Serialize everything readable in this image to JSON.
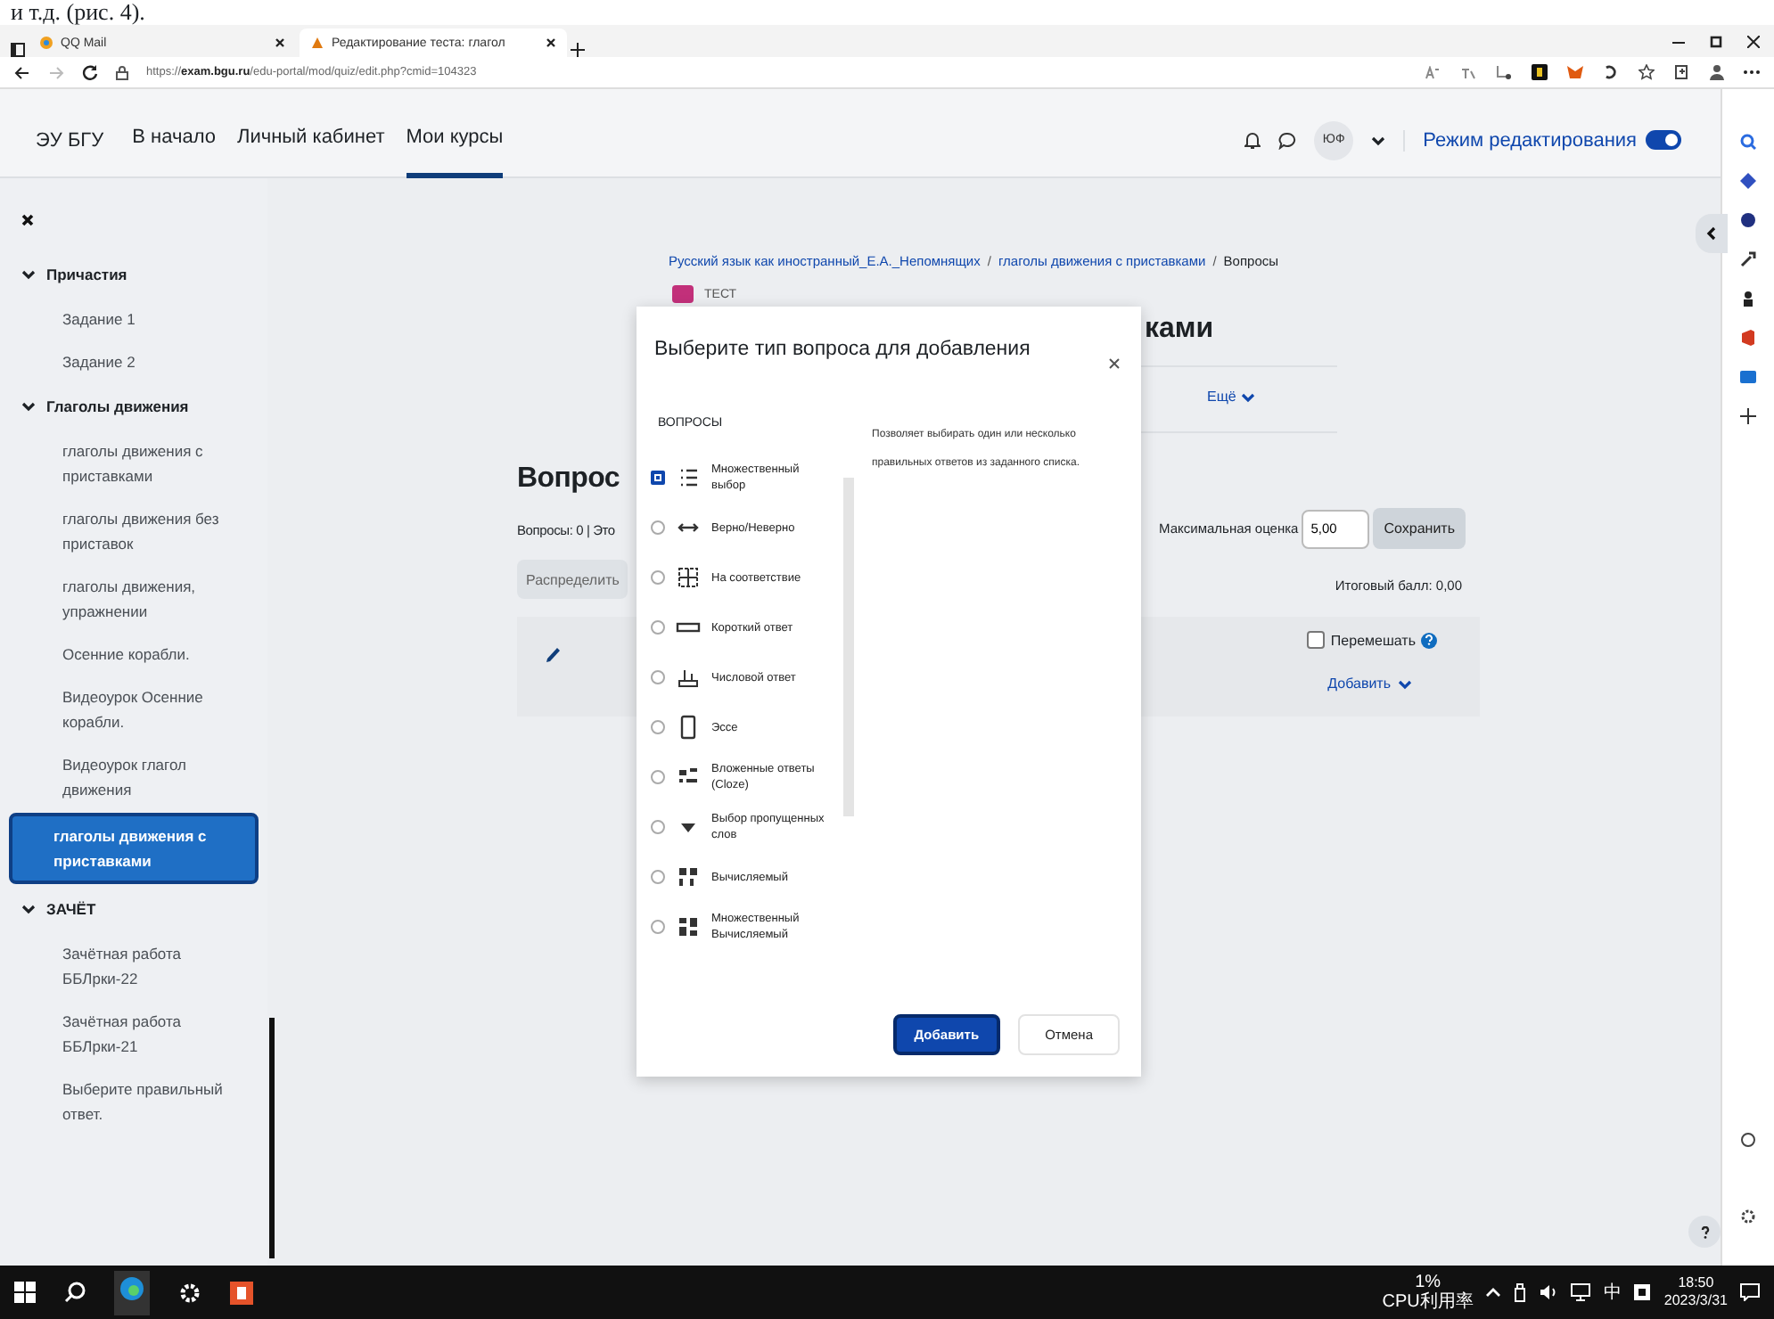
{
  "document_text": "и т.д. (рис. 4).",
  "browser": {
    "tabs": [
      {
        "title": "QQ Mail",
        "selected": false
      },
      {
        "title": "Редактирование теста: глагол",
        "selected": true
      }
    ],
    "url": "https://**exam.bgu.ru**/edu-portal/mod/quiz/edit.php?cmid=104323"
  },
  "nav": {
    "brand": "ЭУ БГУ",
    "links": [
      {
        "label": "В начало",
        "selected": false
      },
      {
        "label": "Личный кабинет",
        "selected": false
      },
      {
        "label": "Мои курсы",
        "selected": true
      }
    ],
    "user_initials": "ЮФ",
    "edit_mode": {
      "label": "Режим редактирования",
      "on": true
    }
  },
  "sidebar": {
    "sections": [
      {
        "title": "Причастия",
        "expanded": true,
        "items": [
          {
            "label": "Задание 1",
            "selected": false
          },
          {
            "label": "Задание 2",
            "selected": false
          }
        ]
      },
      {
        "title": "Глаголы движения",
        "expanded": true,
        "items": [
          {
            "label": "глаголы движения с приставками",
            "selected": false
          },
          {
            "label": "глаголы движения без приставок",
            "selected": false
          },
          {
            "label": "глаголы движения, упражнении",
            "selected": false
          },
          {
            "label": "Осенние корабли.",
            "selected": false
          },
          {
            "label": "Видеоурок Осенние корабли.",
            "selected": false
          },
          {
            "label": "Видеоурок глагол движения",
            "selected": false
          },
          {
            "label": "глаголы движения с приставками",
            "selected": true
          }
        ]
      },
      {
        "title": "ЗАЧЁТ",
        "expanded": true,
        "items": [
          {
            "label": "Зачётная работа ББЛрки-22",
            "selected": false
          },
          {
            "label": "Зачётная работа ББЛрки-21",
            "selected": false
          },
          {
            "label": "Выберите правильный ответ.",
            "selected": false
          }
        ]
      }
    ]
  },
  "page": {
    "breadcrumb": [
      "Русский язык как иностранный_Е.А._Непомнящих",
      "глаголы движения с приставками",
      "Вопросы"
    ],
    "breadcrumb_separator": "/",
    "activity_badge": "ТЕСТ",
    "title": "ками",
    "more_menu": "Ещё",
    "questions_heading": "Вопрос",
    "questions_info": "Вопросы: 0 | Это",
    "repaginate_button": "Распределить",
    "max_grade_label": "Максимальная оценка",
    "max_grade_value": "5,00",
    "save_button": "Сохранить",
    "total": "Итоговый балл: 0,00",
    "shuffle": {
      "label": "Перемешать",
      "checked": false
    },
    "add_menu": "Добавить"
  },
  "dialog": {
    "title": "Выберите тип вопроса для добавления",
    "section_heading": "ВОПРОСЫ",
    "options": [
      {
        "label": "Множественный выбор",
        "kind": "multichoice",
        "selected": true
      },
      {
        "label": "Верно/Неверно",
        "kind": "truefalse",
        "selected": false
      },
      {
        "label": "На соответствие",
        "kind": "match",
        "selected": false
      },
      {
        "label": "Короткий ответ",
        "kind": "shortanswer",
        "selected": false
      },
      {
        "label": "Числовой ответ",
        "kind": "numerical",
        "selected": false
      },
      {
        "label": "Эссе",
        "kind": "essay",
        "selected": false
      },
      {
        "label": "Вложенные ответы (Cloze)",
        "kind": "multianswer",
        "selected": false
      },
      {
        "label": "Выбор пропущенных слов",
        "kind": "gapselect",
        "selected": false
      },
      {
        "label": "Вычисляемый",
        "kind": "calculated",
        "selected": false
      },
      {
        "label": "Множественный Вычисляемый",
        "kind": "calculatedmulti",
        "selected": false
      }
    ],
    "description": "Позволяет выбирать один или несколько правильных ответов из заданного списка.",
    "buttons": [
      {
        "label": "Добавить",
        "kind": "primary"
      },
      {
        "label": "Отмена",
        "kind": "secondary"
      }
    ]
  },
  "taskbar": {
    "cpu_percent": "1%",
    "cpu_label": "CPU利用率",
    "ime": "中",
    "time": "18:50",
    "date": "2023/3/31"
  }
}
